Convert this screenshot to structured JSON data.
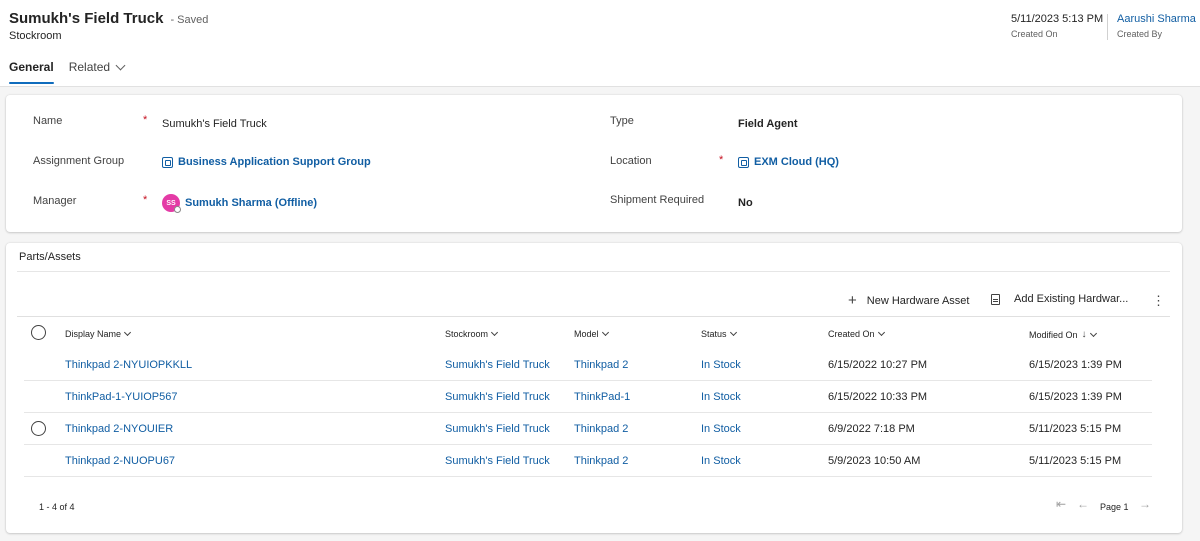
{
  "header": {
    "title": "Sumukh's Field Truck",
    "saved_status": "- Saved",
    "entity": "Stockroom",
    "created_on_value": "5/11/2023 5:13 PM",
    "created_on_label": "Created On",
    "created_by_value": "Aarushi Sharma",
    "created_by_label": "Created By"
  },
  "tabs": [
    {
      "label": "General"
    },
    {
      "label": "Related"
    }
  ],
  "form": {
    "name_label": "Name",
    "name_value": "Sumukh's Field Truck",
    "assignment_group_label": "Assignment Group",
    "assignment_group_value": "Business Application Support Group",
    "manager_label": "Manager",
    "manager_initials": "SS",
    "manager_value": "Sumukh Sharma (Offline)",
    "type_label": "Type",
    "type_value": "Field Agent",
    "location_label": "Location",
    "location_value": "EXM Cloud (HQ)",
    "shipment_label": "Shipment Required",
    "shipment_value": "No",
    "required_marker": "*"
  },
  "grid": {
    "title": "Parts/Assets",
    "new_asset_label": "New Hardware Asset",
    "add_existing_label": "Add Existing Hardwar...",
    "columns": [
      "Display Name",
      "Stockroom",
      "Model",
      "Status",
      "Created On",
      "Modified On"
    ],
    "rows": [
      {
        "name": "Thinkpad 2-NYUIOPKKLL",
        "stockroom": "Sumukh's Field Truck",
        "model": "Thinkpad 2",
        "status": "In Stock",
        "created": "6/15/2022 10:27 PM",
        "modified": "6/15/2023 1:39 PM"
      },
      {
        "name": "ThinkPad-1-YUIOP567",
        "stockroom": "Sumukh's Field Truck",
        "model": "ThinkPad-1",
        "status": "In Stock",
        "created": "6/15/2022 10:33 PM",
        "modified": "6/15/2023 1:39 PM"
      },
      {
        "name": "Thinkpad 2-NYOUIER",
        "stockroom": "Sumukh's Field Truck",
        "model": "Thinkpad 2",
        "status": "In Stock",
        "created": "6/9/2022 7:18 PM",
        "modified": "5/11/2023 5:15 PM"
      },
      {
        "name": "Thinkpad 2-NUOPU67",
        "stockroom": "Sumukh's Field Truck",
        "model": "Thinkpad 2",
        "status": "In Stock",
        "created": "5/9/2023 10:50 AM",
        "modified": "5/11/2023 5:15 PM"
      }
    ],
    "record_count": "1 - 4 of 4",
    "page_label": "Page 1"
  },
  "colors": {
    "accent": "#0f6cbd",
    "link": "#115ea3",
    "required": "#c50f1f",
    "avatar": "#e43ba6"
  }
}
